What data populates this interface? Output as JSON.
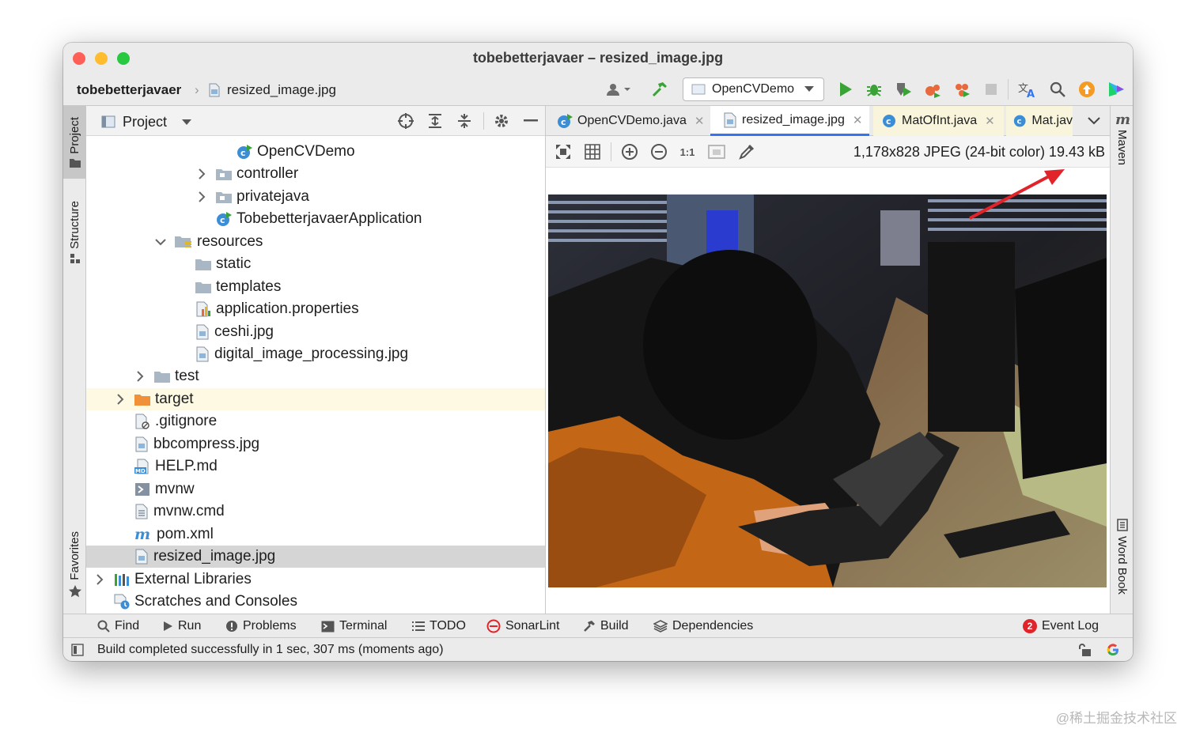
{
  "window": {
    "title": "tobebetterjavaer – resized_image.jpg"
  },
  "navbar": {
    "crumbs": [
      "tobebetterjavaer",
      "resized_image.jpg"
    ],
    "run_config": "OpenCVDemo"
  },
  "left_strip": {
    "tabs": [
      "Project",
      "Structure",
      "Favorites"
    ]
  },
  "right_strip": {
    "tabs": [
      "Maven",
      "Word Book"
    ]
  },
  "project": {
    "header": "Project",
    "tree": [
      {
        "label": "OpenCVDemo",
        "icon": "java-class-run-icon"
      },
      {
        "label": "controller",
        "icon": "package-icon",
        "expander": "collapsed"
      },
      {
        "label": "privatejava",
        "icon": "package-icon",
        "expander": "collapsed"
      },
      {
        "label": "TobebetterjavaerApplication",
        "icon": "java-class-run-icon"
      },
      {
        "label": "resources",
        "icon": "resources-folder-icon",
        "expander": "expanded"
      },
      {
        "label": "static",
        "icon": "folder-icon"
      },
      {
        "label": "templates",
        "icon": "folder-icon"
      },
      {
        "label": "application.properties",
        "icon": "properties-file-icon"
      },
      {
        "label": "ceshi.jpg",
        "icon": "image-file-icon"
      },
      {
        "label": "digital_image_processing.jpg",
        "icon": "image-file-icon"
      },
      {
        "label": "test",
        "icon": "folder-icon",
        "expander": "collapsed"
      },
      {
        "label": "target",
        "icon": "excluded-folder-icon",
        "expander": "collapsed",
        "highlight": true
      },
      {
        "label": ".gitignore",
        "icon": "gitignore-file-icon"
      },
      {
        "label": "bbcompress.jpg",
        "icon": "image-file-icon"
      },
      {
        "label": "HELP.md",
        "icon": "markdown-file-icon"
      },
      {
        "label": "mvnw",
        "icon": "shell-file-icon"
      },
      {
        "label": "mvnw.cmd",
        "icon": "text-file-icon"
      },
      {
        "label": "pom.xml",
        "icon": "maven-icon"
      },
      {
        "label": "resized_image.jpg",
        "icon": "image-file-icon",
        "selected": true
      },
      {
        "label": "External Libraries",
        "icon": "libraries-icon",
        "expander": "collapsed"
      },
      {
        "label": "Scratches and Consoles",
        "icon": "scratches-icon"
      }
    ]
  },
  "editor": {
    "tabs": [
      {
        "label": "OpenCVDemo.java",
        "icon": "java-class-run-icon",
        "closable": true
      },
      {
        "label": "resized_image.jpg",
        "icon": "image-file-icon",
        "closable": true,
        "active": true
      },
      {
        "label": "MatOfInt.java",
        "icon": "java-class-icon",
        "closable": true
      },
      {
        "label": "Mat.jav",
        "icon": "java-class-icon",
        "closable": false
      }
    ],
    "image_info": "1,178x828 JPEG (24-bit color) 19.43 kB"
  },
  "bottom_tools": [
    "Find",
    "Run",
    "Problems",
    "Terminal",
    "TODO",
    "SonarLint",
    "Build",
    "Dependencies"
  ],
  "event_log": {
    "label": "Event Log",
    "count": "2"
  },
  "status": {
    "text": "Build completed successfully in 1 sec, 307 ms (moments ago)"
  },
  "watermark": "@稀土掘金技术社区",
  "colors": {
    "accent": "#3574f0",
    "run_green": "#3aa335",
    "selection": "#d5d5d5",
    "highlight_row": "#fdf9e3",
    "arrow": "#e0242a"
  }
}
